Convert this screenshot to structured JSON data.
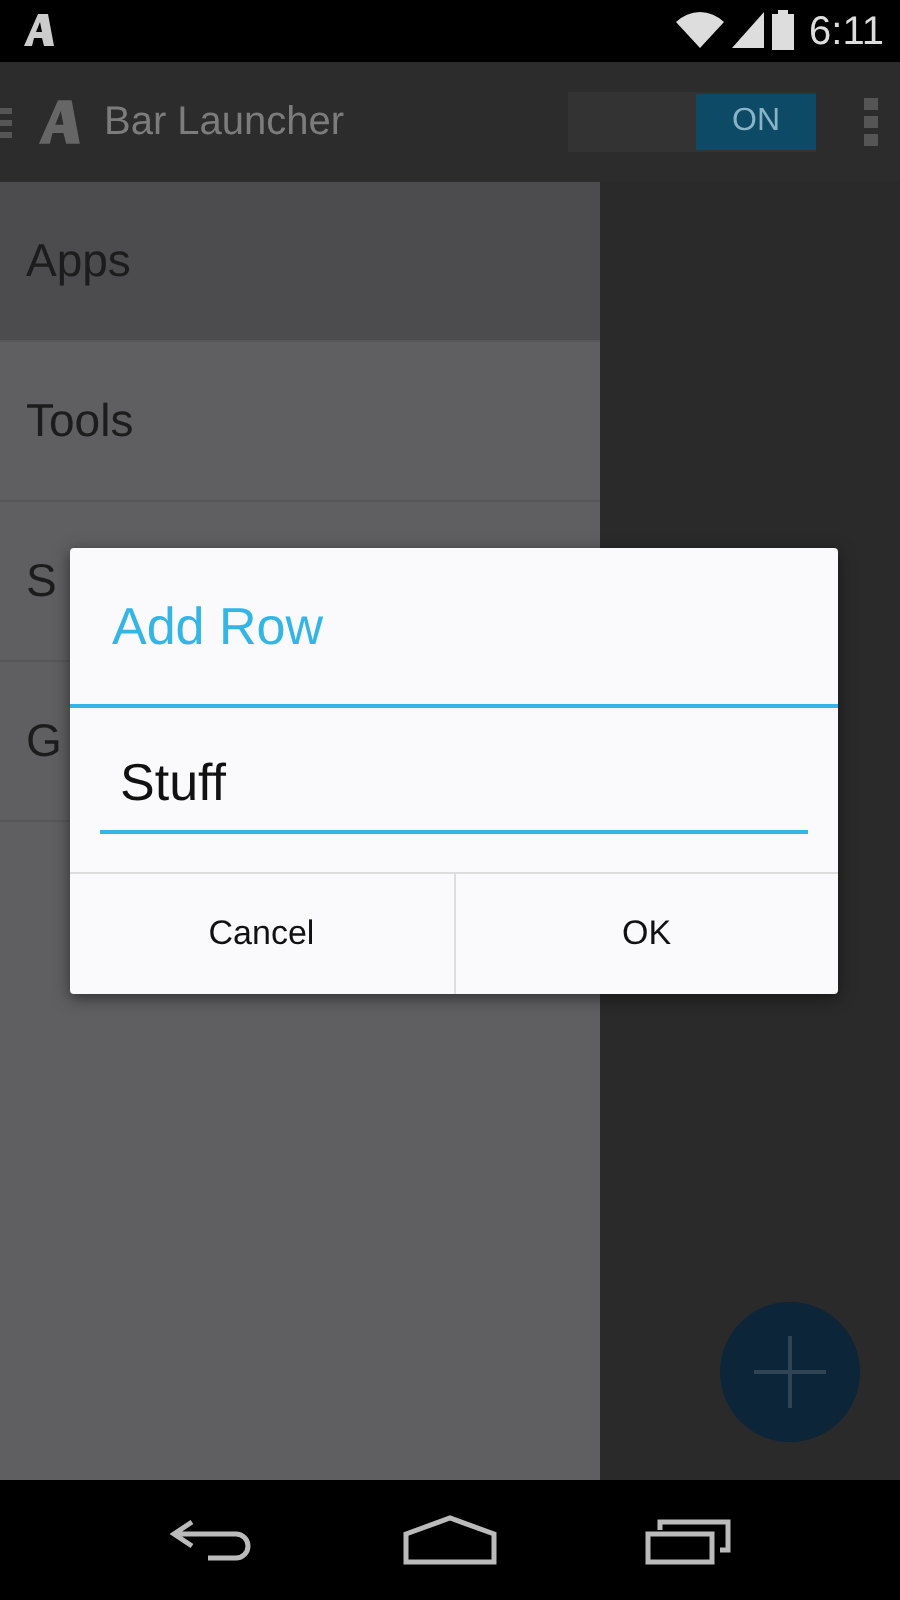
{
  "status_bar": {
    "time": "6:11"
  },
  "action_bar": {
    "title": "Bar Launcher",
    "switch": {
      "label": "ON",
      "on": true
    }
  },
  "drawer": {
    "items": [
      {
        "label": "Apps",
        "selected": true
      },
      {
        "label": "Tools",
        "selected": false
      },
      {
        "label": "S",
        "selected": false
      },
      {
        "label": "G",
        "selected": false
      }
    ]
  },
  "dialog": {
    "title": "Add Row",
    "input": {
      "value": "Stuff"
    },
    "buttons": [
      "Cancel",
      "OK"
    ]
  }
}
